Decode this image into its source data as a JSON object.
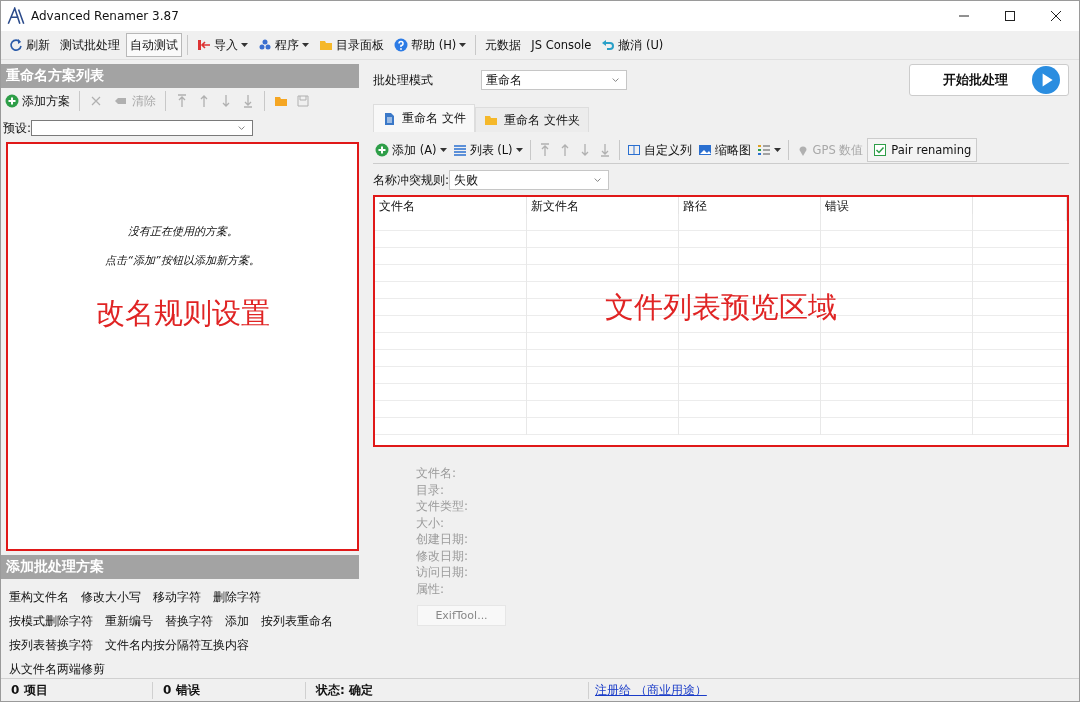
{
  "window": {
    "title": "Advanced Renamer 3.87"
  },
  "toolbar": [
    {
      "label": "刷新",
      "kind": "icon",
      "dropdown": false,
      "selected": false
    },
    {
      "label": "测试批处理",
      "kind": "plain",
      "dropdown": false,
      "selected": false
    },
    {
      "label": "自动测试",
      "kind": "plain",
      "dropdown": false,
      "selected": true
    },
    {
      "label": "导入",
      "kind": "icon",
      "dropdown": true,
      "selected": false
    },
    {
      "label": "程序",
      "kind": "icon",
      "dropdown": true,
      "selected": false
    },
    {
      "label": "目录面板",
      "kind": "icon",
      "dropdown": false,
      "selected": false
    },
    {
      "label": "帮助 (H)",
      "kind": "icon",
      "dropdown": true,
      "selected": false
    },
    {
      "label": "元数据",
      "kind": "plain",
      "dropdown": false,
      "selected": false
    },
    {
      "label": "JS Console",
      "kind": "plain",
      "dropdown": false,
      "selected": false
    },
    {
      "label": "撤消 (U)",
      "kind": "icon",
      "dropdown": false,
      "selected": false
    }
  ],
  "method_list": {
    "title": "重命名方案列表",
    "tools": [
      {
        "label": "添加方案",
        "kind": "add",
        "disabled": false
      },
      {
        "kind": "remove",
        "disabled": true
      },
      {
        "label": "清除",
        "kind": "clear",
        "disabled": true
      },
      {
        "kind": "top",
        "disabled": true
      },
      {
        "kind": "up",
        "disabled": true
      },
      {
        "kind": "down",
        "disabled": true
      },
      {
        "kind": "bottom",
        "disabled": true
      },
      {
        "kind": "open",
        "disabled": false
      },
      {
        "kind": "save",
        "disabled": true
      }
    ],
    "preset_label": "预设:",
    "empty_lines": [
      "没有正在使用的方案。",
      "点击“添加”按钮以添加新方案。"
    ],
    "annotation": "改名规则设置"
  },
  "add_methods": {
    "title": "添加批处理方案",
    "rows": [
      [
        "重构文件名",
        "修改大小写",
        "移动字符",
        "删除字符"
      ],
      [
        "按模式删除字符",
        "重新编号",
        "替换字符",
        "添加",
        "按列表重命名"
      ],
      [
        "按列表替换字符",
        "文件名内按分隔符互换内容"
      ],
      [
        "从文件名两端修剪"
      ]
    ]
  },
  "batch_mode": {
    "label": "批处理模式",
    "value": "重命名"
  },
  "start_button": "开始批处理",
  "tabs": [
    {
      "label": "重命名 文件",
      "selected": true
    },
    {
      "label": "重命名 文件夹",
      "selected": false
    }
  ],
  "file_tools": [
    {
      "label": "添加 (A)",
      "kind": "add",
      "dropdown": true,
      "disabled": false
    },
    {
      "label": "列表 (L)",
      "kind": "list",
      "dropdown": true,
      "disabled": false
    },
    {
      "kind": "top",
      "disabled": true
    },
    {
      "kind": "up",
      "disabled": true
    },
    {
      "kind": "down",
      "disabled": true
    },
    {
      "kind": "bottom",
      "disabled": true
    },
    {
      "label": "自定义列",
      "kind": "columns",
      "dropdown": false,
      "disabled": false
    },
    {
      "label": "缩略图",
      "kind": "thumbs",
      "dropdown": false,
      "disabled": false
    },
    {
      "kind": "view",
      "dropdown": true,
      "disabled": false
    },
    {
      "label": "GPS 数值",
      "kind": "gps",
      "dropdown": false,
      "disabled": true
    },
    {
      "label": "Pair renaming",
      "kind": "check",
      "disabled": false,
      "checked": true
    }
  ],
  "conflict": {
    "label": "名称冲突规则:",
    "value": "失败"
  },
  "file_table": {
    "columns": [
      "文件名",
      "新文件名",
      "路径",
      "错误"
    ],
    "annotation": "文件列表预览区域"
  },
  "info_labels": [
    "文件名:",
    "目录:",
    "文件类型:",
    "大小:",
    "创建日期:",
    "修改日期:",
    "访问日期:",
    "属性:"
  ],
  "exif_button": "ExifTool...",
  "status_bar": {
    "items": "0 项目",
    "errors": "0 错误",
    "state": "状态: 确定",
    "link": "注册给 （商业用途）"
  }
}
